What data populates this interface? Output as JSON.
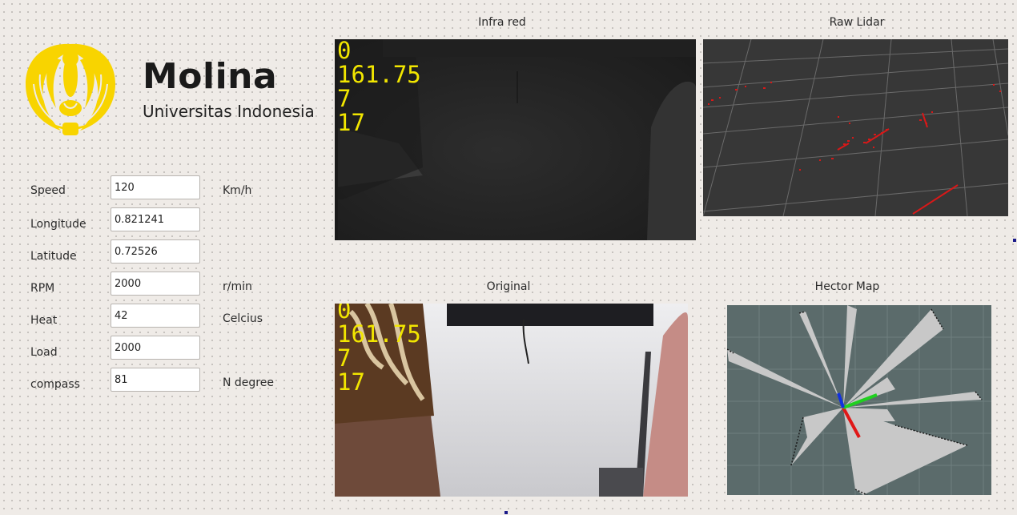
{
  "app": {
    "title": "Molina",
    "subtitle": "Universitas Indonesia",
    "logo_icon": "makara-logo-icon",
    "logo_color": "#f8d400"
  },
  "telemetry": {
    "fields": [
      {
        "label": "Speed",
        "value": "120",
        "unit": "Km/h"
      },
      {
        "label": "Longitude",
        "value": "0.821241",
        "unit": ""
      },
      {
        "label": "Latitude",
        "value": "0.72526",
        "unit": ""
      },
      {
        "label": "RPM",
        "value": "2000",
        "unit": "r/min"
      },
      {
        "label": "Heat",
        "value": "42",
        "unit": "Celcius"
      },
      {
        "label": "Load",
        "value": "2000",
        "unit": ""
      },
      {
        "label": "compass",
        "value": "81",
        "unit": "N degree"
      }
    ]
  },
  "panels": {
    "infrared": {
      "title": "Infra red",
      "overlay": [
        "0",
        "161.75",
        "7",
        "17"
      ]
    },
    "lidar": {
      "title": "Raw Lidar"
    },
    "original": {
      "title": "Original",
      "overlay": [
        "0",
        "161.75",
        "7",
        "17"
      ]
    },
    "hector": {
      "title": "Hector Map"
    }
  },
  "colors": {
    "overlay_text": "#f2e600",
    "lidar_points": "#e01010",
    "map_background": "#5b6b6b"
  }
}
